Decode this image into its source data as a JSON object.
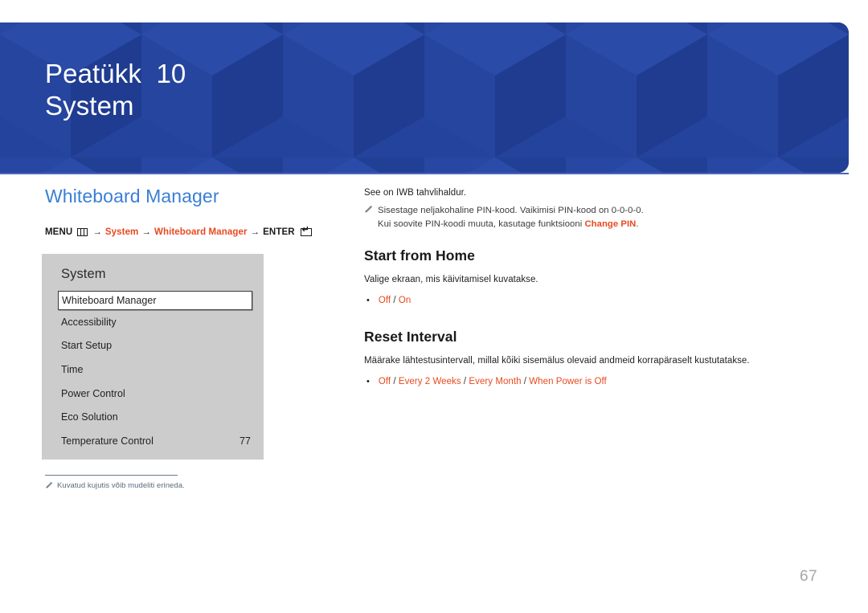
{
  "header": {
    "chapter_label": "Peatükk  10",
    "chapter_name": "System",
    "background_color": "#23439c"
  },
  "left_column": {
    "section_title": "Whiteboard Manager",
    "breadcrumb": {
      "menu_label": "MENU",
      "menu_icon": "menu-grid-icon",
      "arrow_1": "→",
      "crumb_1": "System",
      "arrow_2": "→",
      "crumb_2": "Whiteboard Manager",
      "arrow_3": "→",
      "enter_label": "ENTER",
      "enter_icon": "enter-key-icon"
    },
    "osd": {
      "panel_title": "System",
      "items": [
        {
          "label": "Whiteboard Manager",
          "value": "",
          "selected": true
        },
        {
          "label": "Accessibility",
          "value": "",
          "selected": false
        },
        {
          "label": "Start Setup",
          "value": "",
          "selected": false
        },
        {
          "label": "Time",
          "value": "",
          "selected": false
        },
        {
          "label": "Power Control",
          "value": "",
          "selected": false
        },
        {
          "label": "Eco Solution",
          "value": "",
          "selected": false
        },
        {
          "label": "Temperature Control",
          "value": "77",
          "selected": false
        }
      ]
    },
    "footnote": {
      "icon": "pencil-icon",
      "text": "Kuvatud kujutis võib mudeliti erineda."
    }
  },
  "right_column": {
    "intro": "See on IWB tahvlihaldur.",
    "note": {
      "icon": "pencil-icon",
      "line_1": "Sisestage neljakohaline PIN-kood. Vaikimisi PIN-kood on 0-0-0-0.",
      "line_2_pre": "Kui soovite PIN-koodi muuta, kasutage funktsiooni ",
      "line_2_highlight": "Change PIN",
      "line_2_post": "."
    },
    "sections": [
      {
        "heading": "Start from Home",
        "description": "Valige ekraan, mis käivitamisel kuvatakse.",
        "options": [
          "Off",
          "On"
        ],
        "separator": "/"
      },
      {
        "heading": "Reset Interval",
        "description": "Määrake lähtestusintervall, millal kõiki sisemälus olevaid andmeid korrapäraselt kustutatakse.",
        "options": [
          "Off",
          "Every 2 Weeks",
          "Every Month",
          "When Power is Off"
        ],
        "separator": "/"
      }
    ]
  },
  "footer": {
    "page_number": "67"
  },
  "colors": {
    "banner_blue": "#23439c",
    "link_blue": "#3a7fd5",
    "accent_orange": "#e8491f",
    "osd_gray": "#cccccc",
    "page_number_gray": "#a6a6a6"
  }
}
